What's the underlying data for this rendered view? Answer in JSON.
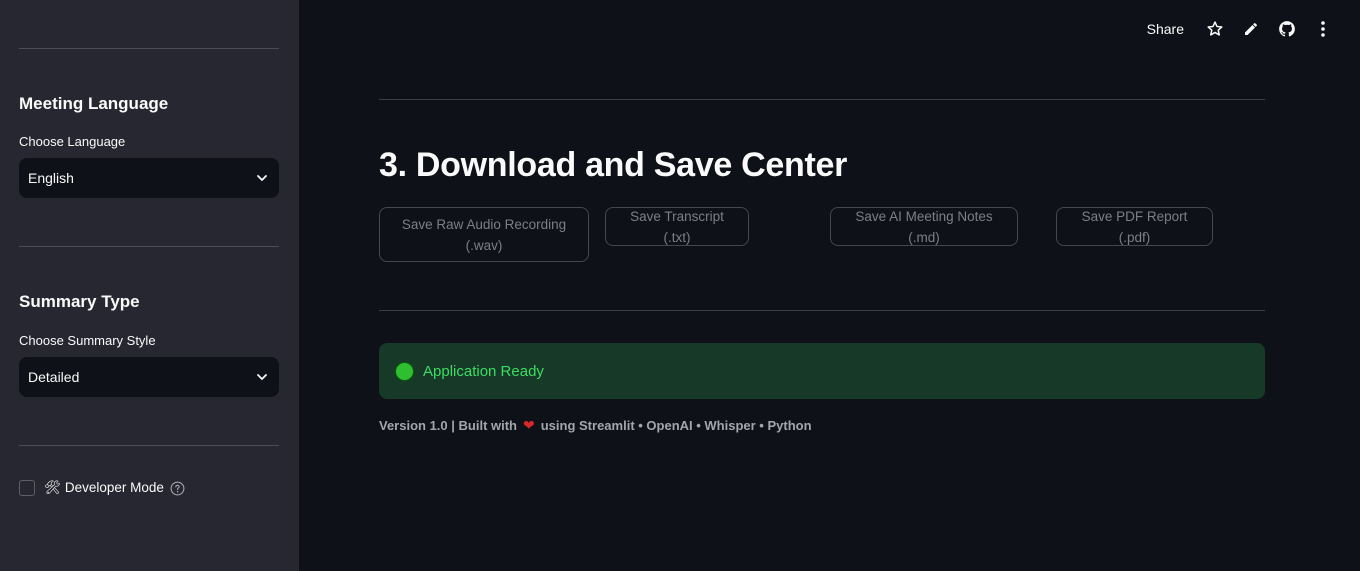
{
  "sidebar": {
    "language": {
      "heading": "Meeting Language",
      "label": "Choose Language",
      "selected": "English"
    },
    "summary": {
      "heading": "Summary Type",
      "label": "Choose Summary Style",
      "selected": "Detailed"
    },
    "developer_mode": {
      "label": "🛠 Developer Mode",
      "checked": false
    }
  },
  "topbar": {
    "share_label": "Share",
    "icons": [
      "star-icon",
      "pencil-icon",
      "github-icon",
      "more-vertical-icon"
    ]
  },
  "main": {
    "title": "3. Download and Save Center",
    "buttons": {
      "audio_line1": "Save Raw Audio Recording",
      "audio_line2": "(.wav)",
      "transcript": "Save Transcript (.txt)",
      "notes": "Save AI Meeting Notes (.md)",
      "pdf": "Save PDF Report (.pdf)"
    },
    "status": {
      "text": "Application Ready",
      "color": "#2fbe2f"
    },
    "footer": {
      "prefix": "Version 1.0 | Built with",
      "suffix": "using Streamlit • OpenAI • Whisper • Python"
    }
  },
  "colors": {
    "background": "#0e1117",
    "sidebar": "#262730",
    "status_bg": "#173928",
    "status_text": "#3ddc62",
    "heart": "#d62828"
  }
}
